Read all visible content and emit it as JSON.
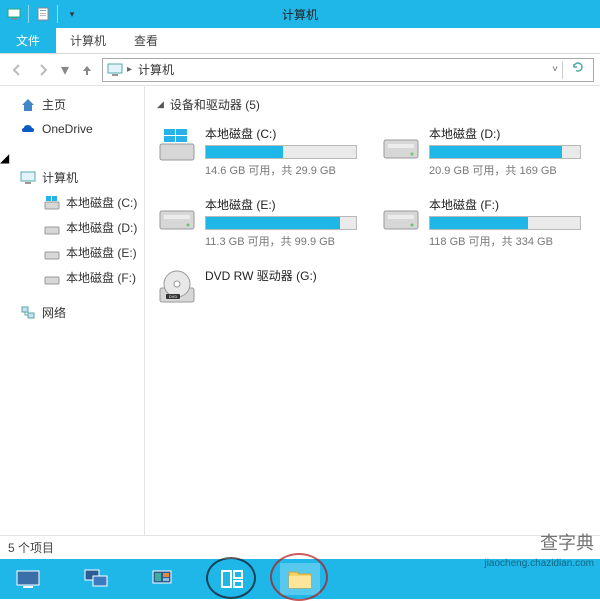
{
  "window": {
    "title": "计算机"
  },
  "tabs": {
    "file": "文件",
    "computer": "计算机",
    "view": "查看"
  },
  "address": {
    "crumb": "计算机"
  },
  "sidebar": {
    "home": "主页",
    "onedrive": "OneDrive",
    "computer": "计算机",
    "computer_children": [
      {
        "label": "本地磁盘 (C:)"
      },
      {
        "label": "本地磁盘 (D:)"
      },
      {
        "label": "本地磁盘 (E:)"
      },
      {
        "label": "本地磁盘 (F:)"
      }
    ],
    "network": "网络"
  },
  "section": {
    "title": "设备和驱动器 (5)"
  },
  "drives": [
    {
      "name": "本地磁盘 (C:)",
      "stats": "14.6 GB 可用，共 29.9 GB",
      "fill_pct": 51,
      "type": "os"
    },
    {
      "name": "本地磁盘 (D:)",
      "stats": "20.9 GB 可用，共 169 GB",
      "fill_pct": 88,
      "type": "hdd"
    },
    {
      "name": "本地磁盘 (E:)",
      "stats": "11.3 GB 可用，共 99.9 GB",
      "fill_pct": 89,
      "type": "hdd"
    },
    {
      "name": "本地磁盘 (F:)",
      "stats": "118 GB 可用，共 334 GB",
      "fill_pct": 65,
      "type": "hdd"
    },
    {
      "name": "DVD RW 驱动器 (G:)",
      "stats": "",
      "fill_pct": null,
      "type": "dvd"
    }
  ],
  "status": {
    "count": "5 个项目"
  },
  "watermark": {
    "main": "查字典",
    "sub": "jiaocheng.chazidian.com"
  }
}
